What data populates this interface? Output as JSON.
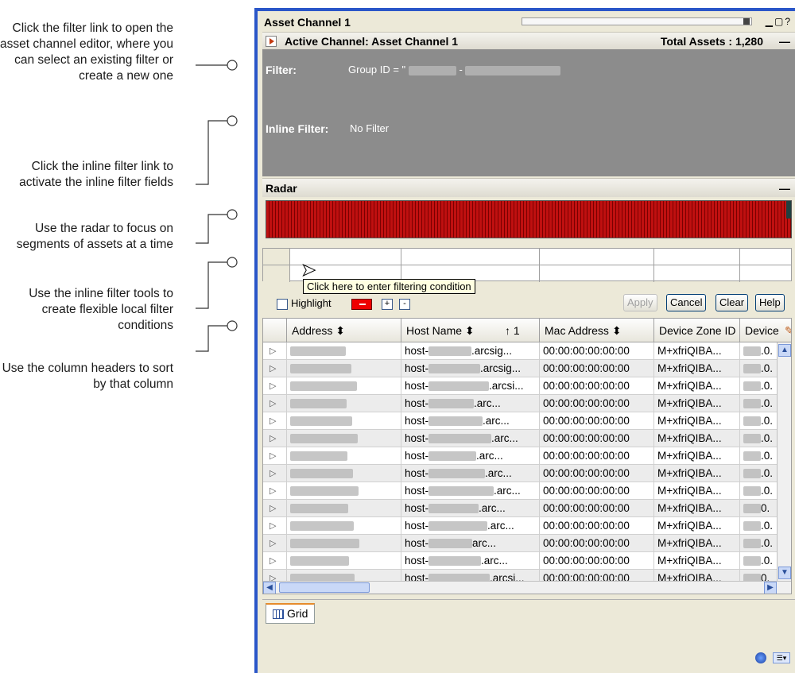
{
  "callouts": [
    {
      "text": "Click the filter link to open the asset channel editor, where you can select an existing filter or create a new one"
    },
    {
      "text": "Click the inline filter link to activate the inline filter fields"
    },
    {
      "text": "Use the radar to focus on segments of assets at a time"
    },
    {
      "text": "Use the inline filter tools to create flexible local filter conditions"
    },
    {
      "text": "Use the column headers to sort by that column"
    }
  ],
  "window": {
    "title": "Asset Channel 1",
    "controls": "▁▢? "
  },
  "active_channel": {
    "label": "Active Channel: Asset Channel 1",
    "total": "Total Assets : 1,280",
    "minimize": "—"
  },
  "filter": {
    "label": "Filter:",
    "value_prefix": "Group ID = \"",
    "inline_label": "Inline Filter:",
    "inline_value": "No Filter"
  },
  "radar": {
    "title": "Radar",
    "minimize": "—"
  },
  "inline_filter": {
    "tooltip": "Click here to enter filtering condition",
    "highlight_label": "Highlight",
    "plus": "+",
    "minus": "-",
    "apply": "Apply",
    "cancel": "Cancel",
    "clear": "Clear",
    "help": "Help"
  },
  "table": {
    "columns": [
      {
        "label": "Address ⬍"
      },
      {
        "label": "Host Name ⬍"
      },
      {
        "label": "↑ 1"
      },
      {
        "label": "Mac Address ⬍"
      },
      {
        "label": "Device Zone ID"
      },
      {
        "label": "Device"
      }
    ],
    "rows": [
      {
        "host": "host-",
        "suffix": ".arcsig...",
        "mac": "00:00:00:00:00:00",
        "zone": "M+xfriQIBA...",
        "device": ".0."
      },
      {
        "host": "host-",
        "suffix": ".arcsig...",
        "mac": "00:00:00:00:00:00",
        "zone": "M+xfriQIBA...",
        "device": ".0."
      },
      {
        "host": "host-",
        "suffix": ".arcsi...",
        "mac": "00:00:00:00:00:00",
        "zone": "M+xfriQIBA...",
        "device": ".0."
      },
      {
        "host": "host-",
        "suffix": ".arc...",
        "mac": "00:00:00:00:00:00",
        "zone": "M+xfriQIBA...",
        "device": ".0."
      },
      {
        "host": "host-",
        "suffix": ".arc...",
        "mac": "00:00:00:00:00:00",
        "zone": "M+xfriQIBA...",
        "device": ".0."
      },
      {
        "host": "host-",
        "suffix": ".arc...",
        "mac": "00:00:00:00:00:00",
        "zone": "M+xfriQIBA...",
        "device": ".0."
      },
      {
        "host": "host-",
        "suffix": ".arc...",
        "mac": "00:00:00:00:00:00",
        "zone": "M+xfriQIBA...",
        "device": ".0."
      },
      {
        "host": "host-",
        "suffix": ".arc...",
        "mac": "00:00:00:00:00:00",
        "zone": "M+xfriQIBA...",
        "device": ".0."
      },
      {
        "host": "host-",
        "suffix": ".arc...",
        "mac": "00:00:00:00:00:00",
        "zone": "M+xfriQIBA...",
        "device": ".0."
      },
      {
        "host": "host-",
        "suffix": ".arc...",
        "mac": "00:00:00:00:00:00",
        "zone": "M+xfriQIBA...",
        "device": "0."
      },
      {
        "host": "host-",
        "suffix": ".arc...",
        "mac": "00:00:00:00:00:00",
        "zone": "M+xfriQIBA...",
        "device": ".0."
      },
      {
        "host": "host-",
        "suffix": "arc...",
        "mac": "00:00:00:00:00:00",
        "zone": "M+xfriQIBA...",
        "device": ".0."
      },
      {
        "host": "host-",
        "suffix": ".arc...",
        "mac": "00:00:00:00:00:00",
        "zone": "M+xfriQIBA...",
        "device": ".0."
      },
      {
        "host": "host-",
        "suffix": ".arcsi...",
        "mac": "00:00:00:00:00:00",
        "zone": "M+xfriQIBA...",
        "device": "0."
      }
    ]
  },
  "tabs": [
    {
      "label": "Grid"
    }
  ],
  "colors": {
    "accent": "#2a56c8",
    "radar": "#c01010",
    "panel": "#8c8c8c"
  }
}
